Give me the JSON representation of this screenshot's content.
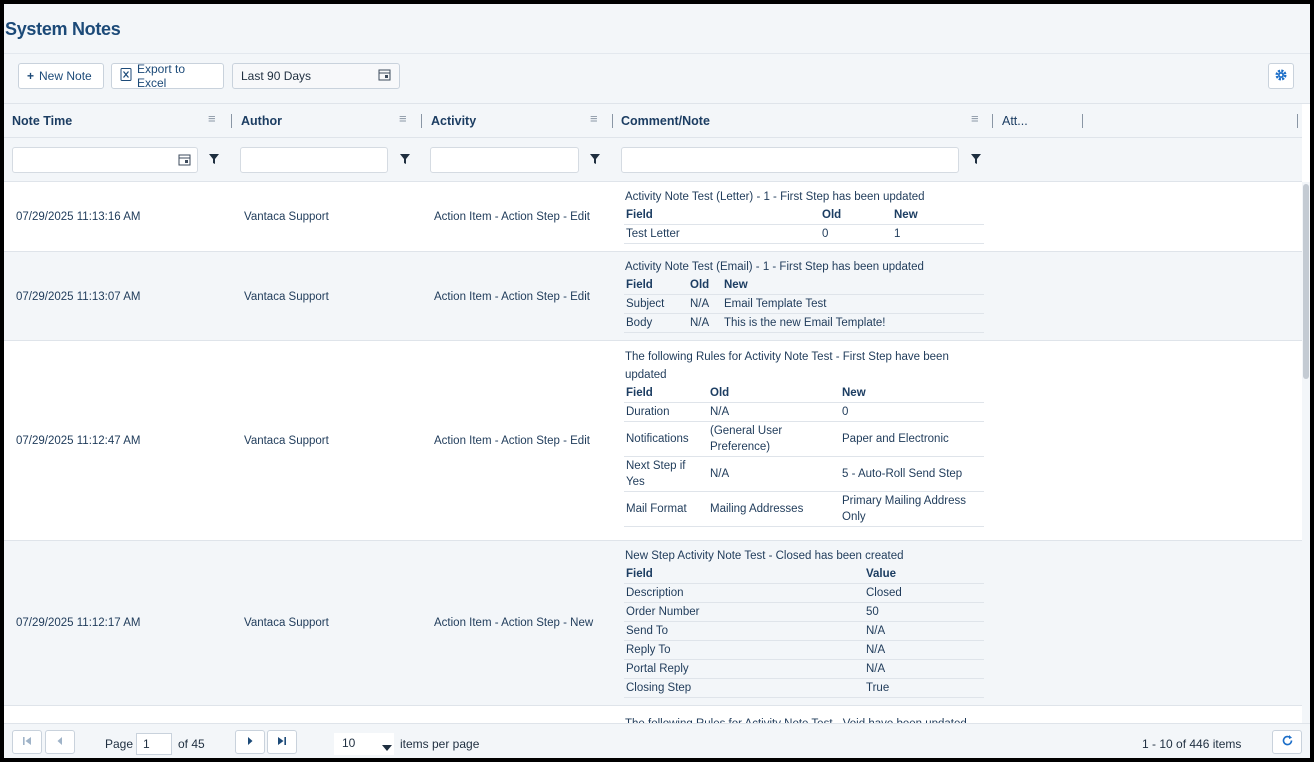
{
  "page": {
    "title": "System Notes"
  },
  "toolbar": {
    "new_note": "New Note",
    "export": "Export to Excel",
    "date_range": "Last 90 Days"
  },
  "columns": {
    "note_time": "Note Time",
    "author": "Author",
    "activity": "Activity",
    "comment": "Comment/Note",
    "attachments": "Att..."
  },
  "rows": [
    {
      "time": "07/29/2025 11:13:16 AM",
      "author": "Vantaca Support",
      "activity": "Action Item - Action Step - Edit",
      "comment_title": "Activity Note Test (Letter) - 1 - First Step has been updated",
      "headers": [
        "Field",
        "Old",
        "New"
      ],
      "data": [
        [
          "Test Letter",
          "0",
          "1"
        ]
      ]
    },
    {
      "time": "07/29/2025 11:13:07 AM",
      "author": "Vantaca Support",
      "activity": "Action Item - Action Step - Edit",
      "comment_title": "Activity Note Test (Email) - 1 - First Step has been updated",
      "headers": [
        "Field",
        "Old",
        "New"
      ],
      "data": [
        [
          "Subject",
          "N/A",
          "Email Template Test"
        ],
        [
          "Body",
          "N/A",
          "This is the new Email Template!"
        ]
      ]
    },
    {
      "time": "07/29/2025 11:12:47 AM",
      "author": "Vantaca Support",
      "activity": "Action Item - Action Step - Edit",
      "comment_title": "The following Rules for Activity Note Test - First Step have been updated",
      "headers": [
        "Field",
        "Old",
        "New"
      ],
      "data": [
        [
          "Duration",
          "N/A",
          "0"
        ],
        [
          "Notifications",
          "(General User Preference)",
          "Paper and Electronic"
        ],
        [
          "Next Step if Yes",
          "N/A",
          "5 - Auto-Roll Send Step"
        ],
        [
          "Mail Format",
          "Mailing Addresses",
          "Primary Mailing Address Only"
        ]
      ]
    },
    {
      "time": "07/29/2025 11:12:17 AM",
      "author": "Vantaca Support",
      "activity": "Action Item - Action Step - New",
      "comment_title": "New Step Activity Note Test - Closed has been created",
      "headers": [
        "Field",
        "Value"
      ],
      "data": [
        [
          "Description",
          "Closed"
        ],
        [
          "Order Number",
          "50"
        ],
        [
          "Send To",
          "N/A"
        ],
        [
          "Reply To",
          "N/A"
        ],
        [
          "Portal Reply",
          "N/A"
        ],
        [
          "Closing Step",
          "True"
        ]
      ]
    },
    {
      "comment_title": "The following Rules for Activity Note Test - Void have been updated"
    }
  ],
  "pager": {
    "page_label": "Page",
    "page": "1",
    "of_label": "of 45",
    "page_size": "10",
    "per_page_label": "items per page",
    "summary": "1 - 10 of 446 items"
  },
  "colors": {
    "accent": "#1c4a78",
    "row_alt": "#f3f6f9",
    "border": "#dfe4ea"
  }
}
